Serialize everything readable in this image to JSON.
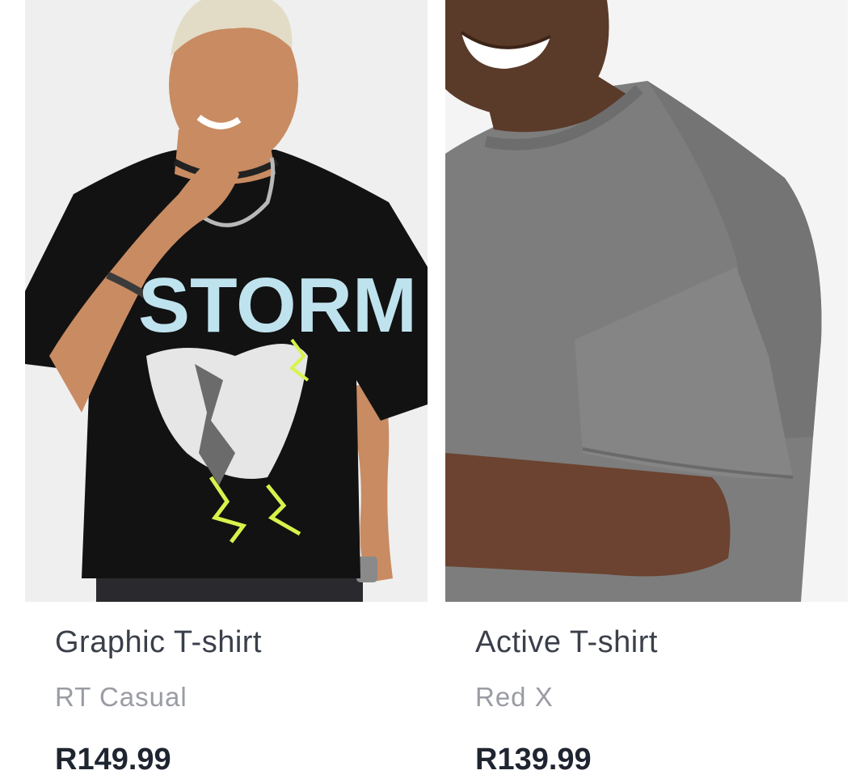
{
  "products": [
    {
      "name": "Graphic T-shirt",
      "brand": "RT Casual",
      "price": "R149.99",
      "print_text": "STORM",
      "colors": {
        "shirt": "#121212",
        "background": "#efefef"
      }
    },
    {
      "name": "Active T-shirt",
      "brand": "Red X",
      "price": "R139.99",
      "colors": {
        "shirt": "#7d7d7d",
        "background": "#f4f4f4"
      }
    }
  ]
}
